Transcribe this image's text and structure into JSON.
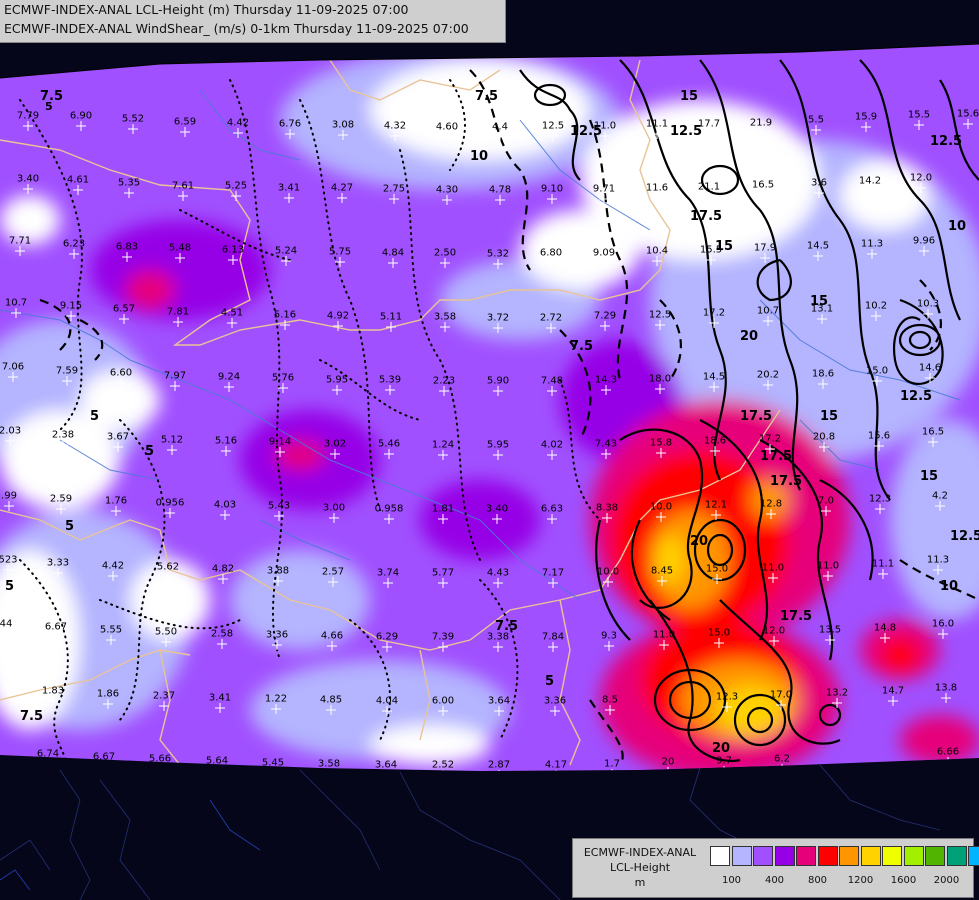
{
  "header": {
    "line1": "ECMWF-INDEX-ANAL LCL-Height (m) Thursday 11-09-2025 07:00",
    "line2": "ECMWF-INDEX-ANAL WindShear_ (m/s) 0-1km Thursday 11-09-2025 07:00"
  },
  "legend": {
    "title1": "ECMWF-INDEX-ANAL",
    "title2": "LCL-Height",
    "unit": "m",
    "colors": [
      "#ffffff",
      "#b4b4ff",
      "#a050ff",
      "#9600e6",
      "#e6007a",
      "#ff0000",
      "#ff9600",
      "#ffd200",
      "#f0ff00",
      "#a0f000",
      "#50b400",
      "#00a078",
      "#00b4ff"
    ],
    "ticks": [
      "100",
      "400",
      "800",
      "1200",
      "1600",
      "2000"
    ]
  },
  "station_values": [
    [
      "7.79",
      28,
      116
    ],
    [
      "6.90",
      81,
      116
    ],
    [
      "5.52",
      133,
      119
    ],
    [
      "6.59",
      185,
      122
    ],
    [
      "4.42",
      238,
      123
    ],
    [
      "6.76",
      290,
      124
    ],
    [
      "3.08",
      343,
      125
    ],
    [
      "4.32",
      395,
      126
    ],
    [
      "4.60",
      447,
      127
    ],
    [
      "4.4",
      500,
      127
    ],
    [
      "12.5",
      553,
      126
    ],
    [
      "11.0",
      605,
      126
    ],
    [
      "11.1",
      657,
      124
    ],
    [
      "17.7",
      709,
      124
    ],
    [
      "21.9",
      761,
      123
    ],
    [
      "5.5",
      816,
      120
    ],
    [
      "15.9",
      866,
      117
    ],
    [
      "15.5",
      919,
      115
    ],
    [
      "15.6",
      968,
      114
    ],
    [
      "3.40",
      28,
      179
    ],
    [
      "4.61",
      78,
      180
    ],
    [
      "5.35",
      129,
      183
    ],
    [
      "7.61",
      183,
      186
    ],
    [
      "5.25",
      236,
      186
    ],
    [
      "3.41",
      289,
      188
    ],
    [
      "4.27",
      342,
      188
    ],
    [
      "2.75",
      394,
      189
    ],
    [
      "4.30",
      447,
      190
    ],
    [
      "4.78",
      500,
      190
    ],
    [
      "9.10",
      552,
      189
    ],
    [
      "9.71",
      604,
      189
    ],
    [
      "11.6",
      657,
      188
    ],
    [
      "21.1",
      709,
      187
    ],
    [
      "16.5",
      763,
      185
    ],
    [
      "3.6",
      819,
      183
    ],
    [
      "14.2",
      870,
      181
    ],
    [
      "12.0",
      921,
      178
    ],
    [
      "7.71",
      20,
      241
    ],
    [
      "6.23",
      74,
      244
    ],
    [
      "6.83",
      127,
      247
    ],
    [
      "5.48",
      180,
      248
    ],
    [
      "6.13",
      233,
      250
    ],
    [
      "5.24",
      286,
      251
    ],
    [
      "5.75",
      340,
      252
    ],
    [
      "4.84",
      393,
      253
    ],
    [
      "2.50",
      445,
      253
    ],
    [
      "5.32",
      498,
      254
    ],
    [
      "6.80",
      551,
      253
    ],
    [
      "9.09",
      604,
      253
    ],
    [
      "10.4",
      657,
      251
    ],
    [
      "15.5",
      711,
      250
    ],
    [
      "17.9",
      765,
      248
    ],
    [
      "14.5",
      818,
      246
    ],
    [
      "11.3",
      872,
      244
    ],
    [
      "9.96",
      924,
      241
    ],
    [
      "10.7",
      16,
      303
    ],
    [
      "9.15",
      71,
      306
    ],
    [
      "6.57",
      124,
      309
    ],
    [
      "7.81",
      178,
      312
    ],
    [
      "4.51",
      232,
      313
    ],
    [
      "5.16",
      285,
      315
    ],
    [
      "4.92",
      338,
      316
    ],
    [
      "5.11",
      391,
      317
    ],
    [
      "3.58",
      445,
      317
    ],
    [
      "3.72",
      498,
      318
    ],
    [
      "2.72",
      551,
      318
    ],
    [
      "7.29",
      605,
      316
    ],
    [
      "12.5",
      660,
      315
    ],
    [
      "17.2",
      714,
      313
    ],
    [
      "10.7",
      768,
      311
    ],
    [
      "13.1",
      822,
      309
    ],
    [
      "10.2",
      876,
      306
    ],
    [
      "10.3",
      928,
      304
    ],
    [
      "7.06",
      13,
      367
    ],
    [
      "7.59",
      67,
      371
    ],
    [
      "6.60",
      121,
      373
    ],
    [
      "7.97",
      175,
      376
    ],
    [
      "9.24",
      229,
      377
    ],
    [
      "5.76",
      283,
      378
    ],
    [
      "5.95",
      337,
      380
    ],
    [
      "5.39",
      390,
      380
    ],
    [
      "2.23",
      444,
      381
    ],
    [
      "5.90",
      498,
      381
    ],
    [
      "7.48",
      552,
      381
    ],
    [
      "14.3",
      606,
      380
    ],
    [
      "18.0",
      660,
      379
    ],
    [
      "14.5",
      714,
      377
    ],
    [
      "20.2",
      768,
      375
    ],
    [
      "18.6",
      823,
      374
    ],
    [
      "15.0",
      877,
      371
    ],
    [
      "14.6",
      930,
      368
    ],
    [
      "2.03",
      10,
      431
    ],
    [
      "2.38",
      63,
      435
    ],
    [
      "3.67",
      118,
      437
    ],
    [
      "5.12",
      172,
      440
    ],
    [
      "5.16",
      226,
      441
    ],
    [
      "9.14",
      280,
      442
    ],
    [
      "3.02",
      335,
      444
    ],
    [
      "5.46",
      389,
      444
    ],
    [
      "1.24",
      443,
      445
    ],
    [
      "5.95",
      498,
      445
    ],
    [
      "4.02",
      552,
      445
    ],
    [
      "7.43",
      606,
      444
    ],
    [
      "15.8",
      661,
      443
    ],
    [
      "18.6",
      715,
      441
    ],
    [
      "17.2",
      770,
      439
    ],
    [
      "20.8",
      824,
      437
    ],
    [
      "15.6",
      879,
      436
    ],
    [
      "16.5",
      933,
      432
    ],
    [
      ".99",
      9,
      496
    ],
    [
      "2.59",
      61,
      499
    ],
    [
      "1.76",
      116,
      501
    ],
    [
      "0.956",
      170,
      503
    ],
    [
      "4.03",
      225,
      505
    ],
    [
      "5.43",
      279,
      506
    ],
    [
      "3.00",
      334,
      508
    ],
    [
      "0.958",
      389,
      509
    ],
    [
      "1.81",
      443,
      509
    ],
    [
      "3.40",
      497,
      509
    ],
    [
      "6.63",
      552,
      509
    ],
    [
      "8.38",
      607,
      508
    ],
    [
      "10.0",
      661,
      507
    ],
    [
      "12.1",
      716,
      505
    ],
    [
      "12.8",
      771,
      504
    ],
    [
      "7.0",
      826,
      501
    ],
    [
      "12.3",
      880,
      499
    ],
    [
      "4.2",
      940,
      496
    ],
    [
      "523",
      8,
      560
    ],
    [
      "3.33",
      58,
      563
    ],
    [
      "4.42",
      113,
      566
    ],
    [
      "5.62",
      168,
      567
    ],
    [
      "4.82",
      223,
      569
    ],
    [
      "3.88",
      278,
      571
    ],
    [
      "2.57",
      333,
      572
    ],
    [
      "3.74",
      388,
      573
    ],
    [
      "5.77",
      443,
      573
    ],
    [
      "4.43",
      498,
      573
    ],
    [
      "7.17",
      553,
      573
    ],
    [
      "10.0",
      608,
      572
    ],
    [
      "8.45",
      662,
      571
    ],
    [
      "15.0",
      717,
      569
    ],
    [
      "11.0",
      773,
      568
    ],
    [
      "11.0",
      828,
      566
    ],
    [
      "11.1",
      883,
      564
    ],
    [
      "11.3",
      938,
      560
    ],
    [
      "44",
      6,
      624
    ],
    [
      "6.67",
      56,
      627
    ],
    [
      "5.55",
      111,
      630
    ],
    [
      "5.50",
      166,
      632
    ],
    [
      "2.58",
      222,
      634
    ],
    [
      "3.36",
      277,
      635
    ],
    [
      "4.66",
      332,
      636
    ],
    [
      "6.29",
      387,
      637
    ],
    [
      "7.39",
      443,
      637
    ],
    [
      "3.38",
      498,
      637
    ],
    [
      "7.84",
      553,
      637
    ],
    [
      "9.3",
      609,
      636
    ],
    [
      "11.0",
      664,
      635
    ],
    [
      "15.0",
      719,
      633
    ],
    [
      "12.0",
      774,
      631
    ],
    [
      "13.5",
      830,
      630
    ],
    [
      "14.8",
      885,
      628
    ],
    [
      "16.0",
      943,
      624
    ],
    [
      "1.83",
      53,
      691
    ],
    [
      "1.86",
      108,
      694
    ],
    [
      "2.37",
      164,
      696
    ],
    [
      "3.41",
      220,
      698
    ],
    [
      "1.22",
      276,
      699
    ],
    [
      "4.85",
      331,
      700
    ],
    [
      "4.04",
      387,
      701
    ],
    [
      "6.00",
      443,
      701
    ],
    [
      "3.64",
      499,
      701
    ],
    [
      "3.36",
      555,
      701
    ],
    [
      "8.5",
      610,
      700
    ],
    [
      "12.3",
      727,
      697
    ],
    [
      "17.0",
      781,
      695
    ],
    [
      "13.2",
      837,
      693
    ],
    [
      "14.7",
      893,
      691
    ],
    [
      "13.8",
      946,
      688
    ],
    [
      "6.74",
      48,
      754
    ],
    [
      "6.67",
      104,
      757
    ],
    [
      "5.66",
      160,
      759
    ],
    [
      "5.64",
      217,
      761
    ],
    [
      "5.45",
      273,
      763
    ],
    [
      "3.58",
      329,
      764
    ],
    [
      "3.64",
      386,
      765
    ],
    [
      "2.52",
      443,
      765
    ],
    [
      "2.87",
      499,
      765
    ],
    [
      "4.17",
      556,
      765
    ],
    [
      "1.7",
      612,
      764
    ],
    [
      "20",
      668,
      762
    ],
    [
      "9.7",
      724,
      761
    ],
    [
      "6.2",
      782,
      759
    ],
    [
      "6.66",
      948,
      752
    ]
  ]
}
